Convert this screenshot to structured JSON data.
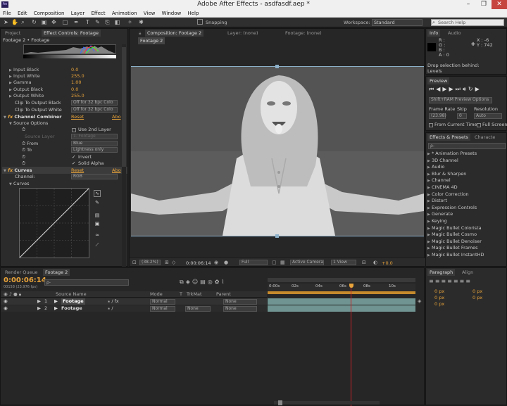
{
  "window": {
    "title": "Adobe After Effects - asdfasdf.aep *",
    "app_icon": "Ae"
  },
  "menu": [
    "File",
    "Edit",
    "Composition",
    "Layer",
    "Effect",
    "Animation",
    "View",
    "Window",
    "Help"
  ],
  "toolbar": {
    "snapping": "Snapping",
    "workspace_label": "Workspace:",
    "workspace_value": "Standard",
    "search_placeholder": "Search Help"
  },
  "left_panel": {
    "tabs": [
      "Project",
      "Effect Controls: Footage"
    ],
    "breadcrumb": "Footage 2 • Footage",
    "levels": [
      {
        "label": "Input Black",
        "value": "0.0"
      },
      {
        "label": "Input White",
        "value": "255.0"
      },
      {
        "label": "Gamma",
        "value": "1.00"
      },
      {
        "label": "Output Black",
        "value": "0.0"
      },
      {
        "label": "Output White",
        "value": "255.0"
      }
    ],
    "clip_black": {
      "label": "Clip To Output Black",
      "value": "Off for 32 bpc Colo"
    },
    "clip_white": {
      "label": "Clip To Output White",
      "value": "Off for 32 bpc Colo"
    },
    "channel_combiner": {
      "name": "Channel Combiner",
      "reset": "Reset",
      "about": "Abo"
    },
    "source_options": "Source Options",
    "use_2nd_layer": "Use 2nd Layer",
    "source_layer": {
      "label": "Source Layer",
      "value": "1. Footage"
    },
    "from": {
      "label": "From",
      "value": "Blue"
    },
    "to": {
      "label": "To",
      "value": "Lightness only"
    },
    "invert": "Invert",
    "solid_alpha": "Solid Alpha",
    "curves": {
      "name": "Curves",
      "reset": "Reset",
      "about": "Abo"
    },
    "channel": {
      "label": "Channel:",
      "value": "RGB"
    },
    "curves_sub": "Curves"
  },
  "comp_panel": {
    "tabs": [
      "Composition: Footage 2",
      "Layer: (none)",
      "Footage: (none)"
    ],
    "subtab": "Footage 2",
    "zoom": "(38.2%)",
    "time": "0:00:06:14",
    "resolution": "Full",
    "camera": "Active Camera",
    "view": "1 View",
    "offset": "+0.0"
  },
  "info_panel": {
    "tabs": [
      "Info",
      "Audio"
    ],
    "r": "R :",
    "g": "G :",
    "b": "B :",
    "a": "A : 0",
    "x": "X : -6",
    "y": "Y : 742",
    "message1": "Drop selection behind:",
    "message2": "Levels"
  },
  "preview_panel": {
    "title": "Preview",
    "options": "Shift+RAM Preview Options",
    "frame_rate_label": "Frame Rate",
    "skip_label": "Skip",
    "resolution_label": "Resolution",
    "frame_rate": "(23.98)",
    "skip": "0",
    "resolution": "Auto",
    "from_current": "From Current Time",
    "full_screen": "Full Screen"
  },
  "effects_panel": {
    "tabs": [
      "Effects & Presets",
      "Characte"
    ],
    "search_placeholder": "ρ-",
    "items": [
      "* Animation Presets",
      "3D Channel",
      "Audio",
      "Blur & Sharpen",
      "Channel",
      "CINEMA 4D",
      "Color Correction",
      "Distort",
      "Expression Controls",
      "Generate",
      "Keying",
      "Magic Bullet Colorista",
      "Magic Bullet Cosmo",
      "Magic Bullet Denoiser",
      "Magic Bullet Frames",
      "Magic Bullet InstantHD"
    ]
  },
  "paragraph_panel": {
    "tabs": [
      "Paragraph",
      "Align"
    ],
    "fields": [
      "0 px",
      "0 px",
      "0 px",
      "0 px",
      "0 px"
    ]
  },
  "timeline": {
    "tabs": [
      "Render Queue",
      "Footage 2"
    ],
    "timecode": "0:00:06:14",
    "fps": "00158 (23.976 fps)",
    "columns": {
      "source": "Source Name",
      "mode": "Mode",
      "t": "T",
      "trkmat": "TrkMat",
      "parent": "Parent"
    },
    "layers": [
      {
        "num": "1",
        "name": "Footage",
        "mode": "Normal",
        "trkmat": "",
        "parent": "None"
      },
      {
        "num": "2",
        "name": "Footage",
        "mode": "Normal",
        "trkmat": "None",
        "parent": "None"
      }
    ],
    "ruler": [
      "0:00s",
      "02s",
      "04s",
      "06s",
      "08s",
      "10s"
    ]
  }
}
